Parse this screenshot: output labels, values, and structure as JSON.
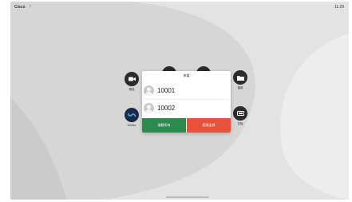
{
  "status_bar": {
    "brand": "Cisco",
    "chevron": "›",
    "time": "11:28"
  },
  "apps": [
    {
      "id": "call",
      "label": "撥話",
      "icon": "video-camera-icon"
    },
    {
      "id": "share",
      "label": "",
      "icon": "share-icon"
    },
    {
      "id": "meet",
      "label": "",
      "icon": "meeting-icon"
    },
    {
      "id": "files",
      "label": "檔案",
      "icon": "folder-icon"
    },
    {
      "id": "webex",
      "label": "Webex",
      "icon": "webex-icon"
    },
    {
      "id": "board",
      "label": "白板",
      "icon": "whiteboard-icon"
    }
  ],
  "dialog": {
    "title": "來電",
    "callers": [
      {
        "number": "10001"
      },
      {
        "number": "10002"
      }
    ],
    "accept_label": "接聽所有",
    "decline_label": "拒絕全部"
  },
  "colors": {
    "accept": "#2d8a4e",
    "decline": "#e5533c"
  }
}
